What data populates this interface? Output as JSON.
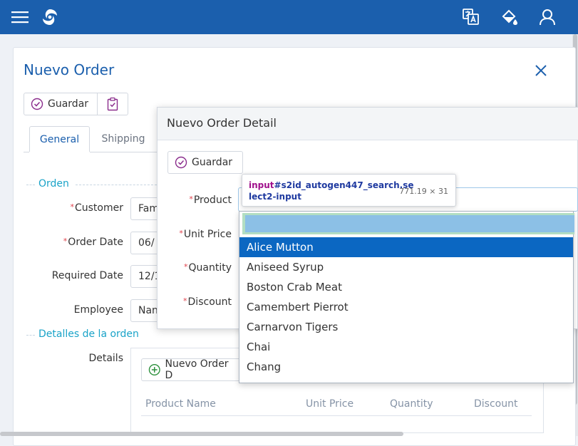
{
  "header": {
    "menu_icon": "hamburger-menu-icon",
    "logo_icon": "app-logo-icon",
    "right_icons": [
      "translate-icon",
      "paint-bucket-icon",
      "user-icon"
    ]
  },
  "form": {
    "title": "Nuevo Order",
    "close_icon": "close-icon",
    "save_label": "Guardar",
    "tabs": [
      {
        "label": "General",
        "active": true
      },
      {
        "label": "Shipping",
        "active": false
      }
    ],
    "section_orden": "Orden",
    "fields": {
      "customer": {
        "label": "Customer",
        "value": "Fam",
        "required": true
      },
      "order_date": {
        "label": "Order Date",
        "value": "06/",
        "required": true
      },
      "required_date": {
        "label": "Required Date",
        "value": "12/1",
        "required": false
      },
      "employee": {
        "label": "Employee",
        "value": "Nan",
        "required": false
      }
    },
    "section_details": "Detalles de la orden",
    "details_label": "Details",
    "new_detail_button": "Nuevo Order D",
    "grid_columns": [
      "Product Name",
      "Unit Price",
      "Quantity",
      "Discount"
    ]
  },
  "modal": {
    "title": "Nuevo Order Detail",
    "save_label": "Guardar",
    "fields": [
      {
        "label": "Product",
        "required": true
      },
      {
        "label": "Unit Price",
        "required": true
      },
      {
        "label": "Quantity",
        "required": true
      },
      {
        "label": "Discount",
        "required": true
      }
    ]
  },
  "inspector_tooltip": {
    "tag": "input",
    "selector_rest": "#s2id_autogen447_search.se\nlect2-input",
    "size": "771.19 × 31"
  },
  "dropdown": {
    "search_value": "",
    "selected": "Alice Mutton",
    "options": [
      "Alice Mutton",
      "Aniseed Syrup",
      "Boston Crab Meat",
      "Camembert Pierrot",
      "Carnarvon Tigers",
      "Chai",
      "Chang"
    ]
  },
  "colors": {
    "header": "#1b5fad",
    "accent": "#1b5fad",
    "section": "#1aa3c8",
    "required": "#e0404a",
    "selected_option": "#0b67c2"
  }
}
